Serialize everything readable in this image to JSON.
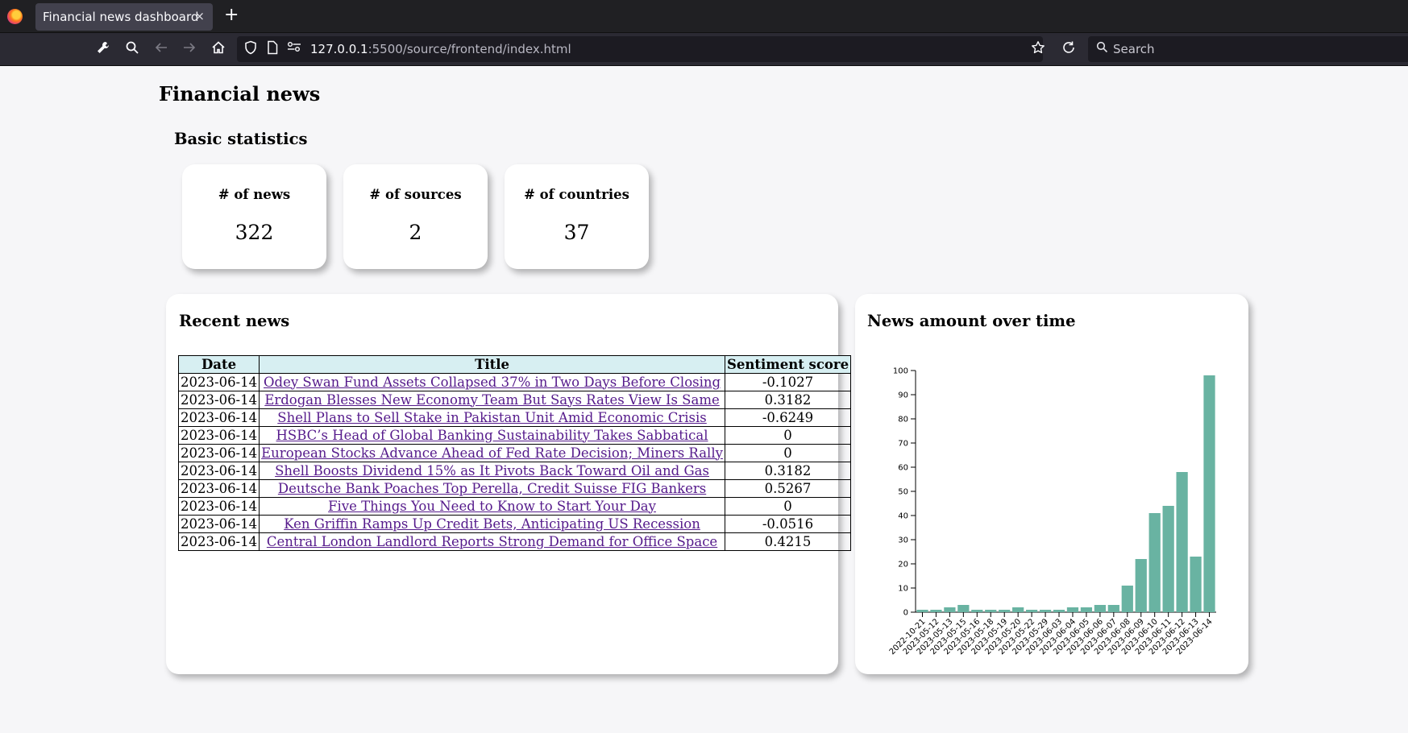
{
  "browser": {
    "tab_title": "Financial news dashboard",
    "tab_close": "×",
    "new_tab": "+",
    "url_host": "127.0.0.1",
    "url_rest": ":5500/source/frontend/index.html",
    "search_placeholder": "Search"
  },
  "page": {
    "title": "Financial news",
    "stats_title": "Basic statistics",
    "stats": [
      {
        "label": "# of news",
        "value": "322"
      },
      {
        "label": "# of sources",
        "value": "2"
      },
      {
        "label": "# of countries",
        "value": "37"
      }
    ]
  },
  "recent_news": {
    "title": "Recent news",
    "columns": [
      "Date",
      "Title",
      "Sentiment score"
    ],
    "rows": [
      {
        "date": "2023-06-14",
        "title": "Odey Swan Fund Assets Collapsed 37% in Two Days Before Closing",
        "score": "-0.1027"
      },
      {
        "date": "2023-06-14",
        "title": "Erdogan Blesses New Economy Team But Says Rates View Is Same",
        "score": "0.3182"
      },
      {
        "date": "2023-06-14",
        "title": "Shell Plans to Sell Stake in Pakistan Unit Amid Economic Crisis",
        "score": "-0.6249"
      },
      {
        "date": "2023-06-14",
        "title": "HSBC’s Head of Global Banking Sustainability Takes Sabbatical",
        "score": "0"
      },
      {
        "date": "2023-06-14",
        "title": "European Stocks Advance Ahead of Fed Rate Decision; Miners Rally",
        "score": "0"
      },
      {
        "date": "2023-06-14",
        "title": "Shell Boosts Dividend 15% as It Pivots Back Toward Oil and Gas",
        "score": "0.3182"
      },
      {
        "date": "2023-06-14",
        "title": "Deutsche Bank Poaches Top Perella, Credit Suisse FIG Bankers",
        "score": "0.5267"
      },
      {
        "date": "2023-06-14",
        "title": "Five Things You Need to Know to Start Your Day",
        "score": "0"
      },
      {
        "date": "2023-06-14",
        "title": "Ken Griffin Ramps Up Credit Bets, Anticipating US Recession",
        "score": "-0.0516"
      },
      {
        "date": "2023-06-14",
        "title": "Central London Landlord Reports Strong Demand for Office Space",
        "score": "0.4215"
      }
    ]
  },
  "chart_panel": {
    "title": "News amount over time"
  },
  "chart_data": {
    "type": "bar",
    "title": "",
    "xlabel": "",
    "ylabel": "",
    "ylim": [
      0,
      100
    ],
    "yticks": [
      0,
      10,
      20,
      30,
      40,
      50,
      60,
      70,
      80,
      90,
      100
    ],
    "bar_color": "#69b3a2",
    "grid": false,
    "categories": [
      "2022-10-21",
      "2023-05-12",
      "2023-05-13",
      "2023-05-15",
      "2023-05-16",
      "2023-05-18",
      "2023-05-19",
      "2023-05-20",
      "2023-05-22",
      "2023-05-29",
      "2023-06-03",
      "2023-06-04",
      "2023-06-05",
      "2023-06-06",
      "2023-06-07",
      "2023-06-08",
      "2023-06-09",
      "2023-06-10",
      "2023-06-11",
      "2023-06-12",
      "2023-06-13",
      "2023-06-14"
    ],
    "values": [
      1,
      1,
      2,
      3,
      1,
      1,
      1,
      2,
      1,
      1,
      1,
      2,
      2,
      3,
      3,
      11,
      22,
      41,
      44,
      58,
      23,
      98
    ]
  }
}
